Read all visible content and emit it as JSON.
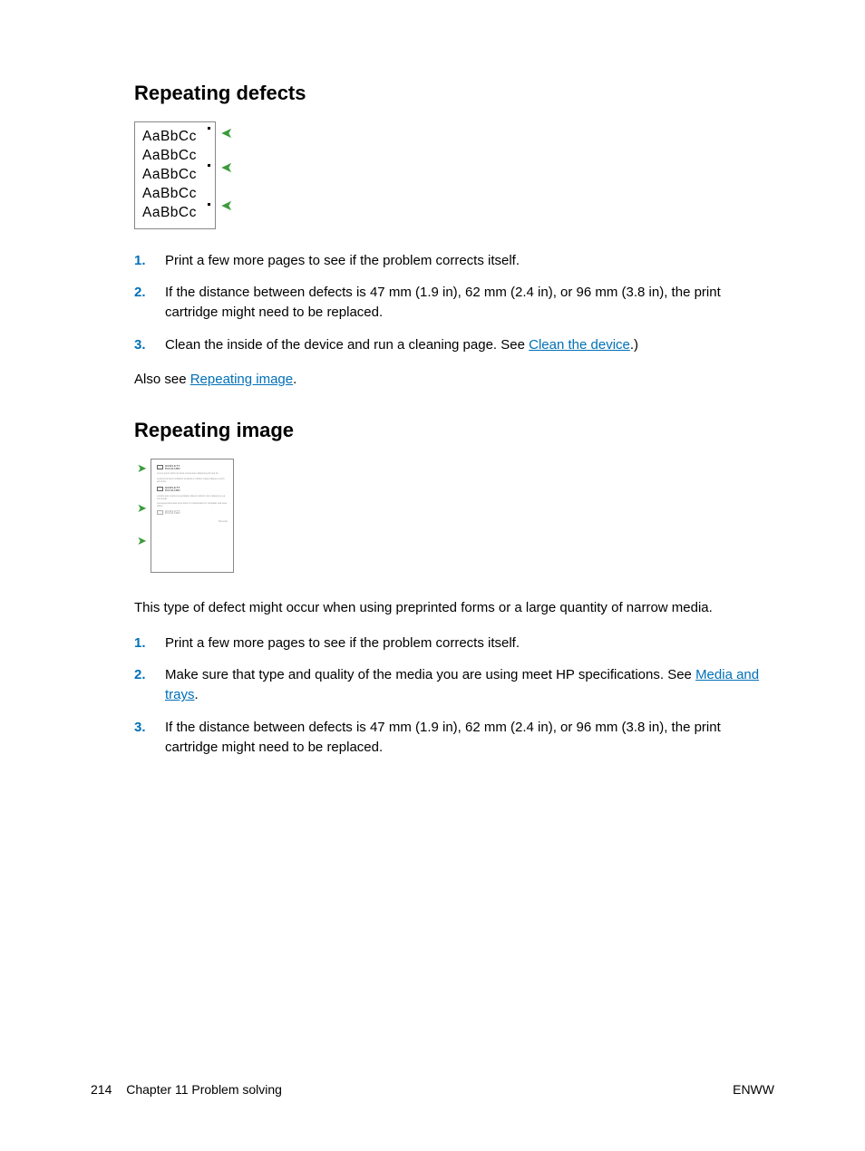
{
  "section1": {
    "heading": "Repeating defects",
    "sample_lines": [
      "AaBbCc",
      "AaBbCc",
      "AaBbCc",
      "AaBbCc",
      "AaBbCc"
    ],
    "steps": [
      {
        "num": "1.",
        "text": "Print a few more pages to see if the problem corrects itself."
      },
      {
        "num": "2.",
        "text": "If the distance between defects is 47 mm (1.9 in), 62 mm (2.4 in), or 96 mm (3.8 in), the print cartridge might need to be replaced."
      },
      {
        "num": "3.",
        "text_before": "Clean the inside of the device and run a cleaning page. See ",
        "link": "Clean the device",
        "text_after": ".)"
      }
    ],
    "also_see_before": "Also see ",
    "also_see_link": "Repeating image",
    "also_see_after": "."
  },
  "section2": {
    "heading": "Repeating image",
    "logo_text": "HEWLETT\nPACKARD",
    "intro": "This type of defect might occur when using preprinted forms or a large quantity of narrow media.",
    "steps": [
      {
        "num": "1.",
        "text": "Print a few more pages to see if the problem corrects itself."
      },
      {
        "num": "2.",
        "text_before": "Make sure that type and quality of the media you are using meet HP specifications. See ",
        "link": "Media and trays",
        "text_after": "."
      },
      {
        "num": "3.",
        "text": "If the distance between defects is 47 mm (1.9 in), 62 mm (2.4 in), or 96 mm (3.8 in), the print cartridge might need to be replaced."
      }
    ]
  },
  "footer": {
    "page_num": "214",
    "chapter": "Chapter 11   Problem solving",
    "right": "ENWW"
  }
}
